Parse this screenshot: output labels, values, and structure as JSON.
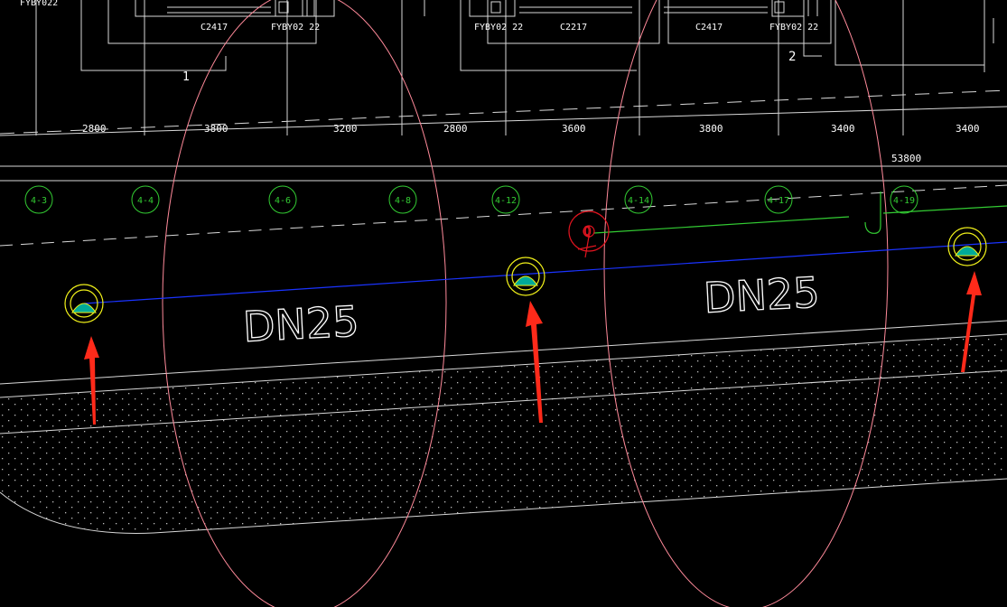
{
  "colors": {
    "background": "#000000",
    "linework": "#d8d8d8",
    "axis_bubble": "#33cc33",
    "coverage_circle": "#ff8a9a",
    "pipe": "#1a33ff",
    "branch_pipe": "#33cc33",
    "sprinkler_ring": "#f2f21a",
    "sprinkler_fill": "#00aa99",
    "arrow": "#ff2a1a",
    "valve_marker": "#e0141f"
  },
  "drawing": {
    "window_tags": [
      "C2417",
      "FYBY02 22",
      "FYBY02 22",
      "C2217",
      "C2417",
      "FYBY02 22"
    ],
    "partial_tag": "FYBY022",
    "room_numbers": [
      "1",
      "2"
    ],
    "dimensions": [
      "2800",
      "3800",
      "3200",
      "2800",
      "3600",
      "3800",
      "3400",
      "3400"
    ],
    "overall_dimension": "53800",
    "axis_bubbles": [
      "4-3",
      "4-4",
      "4-6",
      "4-8",
      "4-12",
      "4-14",
      "4-17",
      "4-19"
    ],
    "pipe_labels": [
      "DN25",
      "DN25"
    ],
    "valve_label": "Q",
    "icons": {
      "sprinkler": "sprinkler-head-icon",
      "arrow": "red-arrow-icon",
      "valve": "valve-marker-icon"
    }
  }
}
